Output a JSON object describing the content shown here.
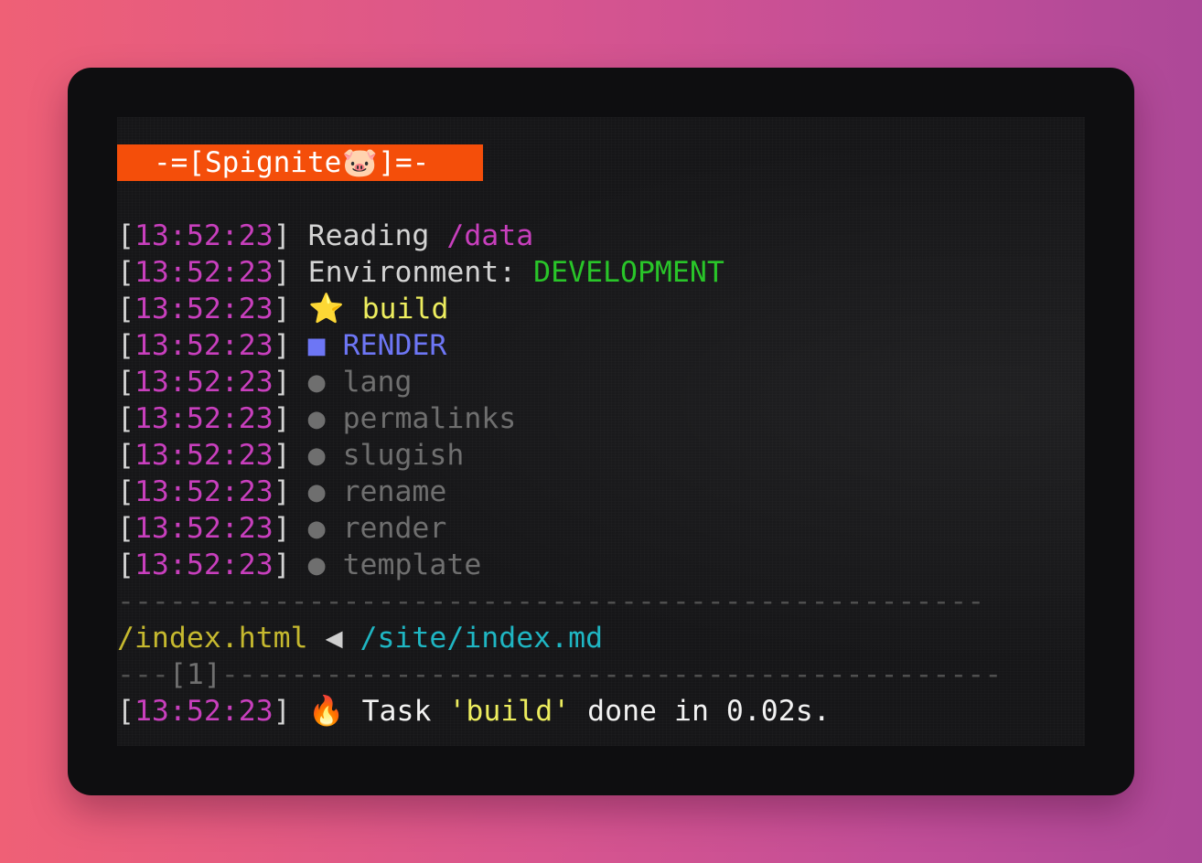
{
  "banner": {
    "prefix": "-=[Spignite",
    "emoji": "🐷",
    "suffix": "]=-"
  },
  "log": {
    "timestamp": "13:52:23",
    "reading_label": "Reading",
    "reading_path": "/data",
    "env_label": "Environment:",
    "env_value": "DEVELOPMENT",
    "build_emoji": "⭐",
    "build_label": "build",
    "render_marker": "■",
    "render_label": "RENDER",
    "step_marker": "●",
    "steps": [
      "lang",
      "permalinks",
      "slugish",
      "rename",
      "render",
      "template"
    ]
  },
  "divider": {
    "rule": "--------------------------------------------------",
    "page_rule_prefix": "---",
    "page_number_label": "[1]",
    "page_rule_suffix": "---------------------------------------------"
  },
  "mapping": {
    "output": "/index.html",
    "arrow": "◀",
    "source": "/site/index.md"
  },
  "done": {
    "emoji": "🔥",
    "task_label": "Task",
    "task_name": "'build'",
    "message": "done in 0.02s."
  },
  "colors": {
    "banner_bg": "#f44e0a",
    "timestamp": "#c83fbd",
    "environment": "#29c529",
    "build": "#eded5e",
    "render": "#6d76f5",
    "step": "#6f6f6f",
    "output_path": "#c6b92f",
    "source_path": "#1fb6c3"
  }
}
